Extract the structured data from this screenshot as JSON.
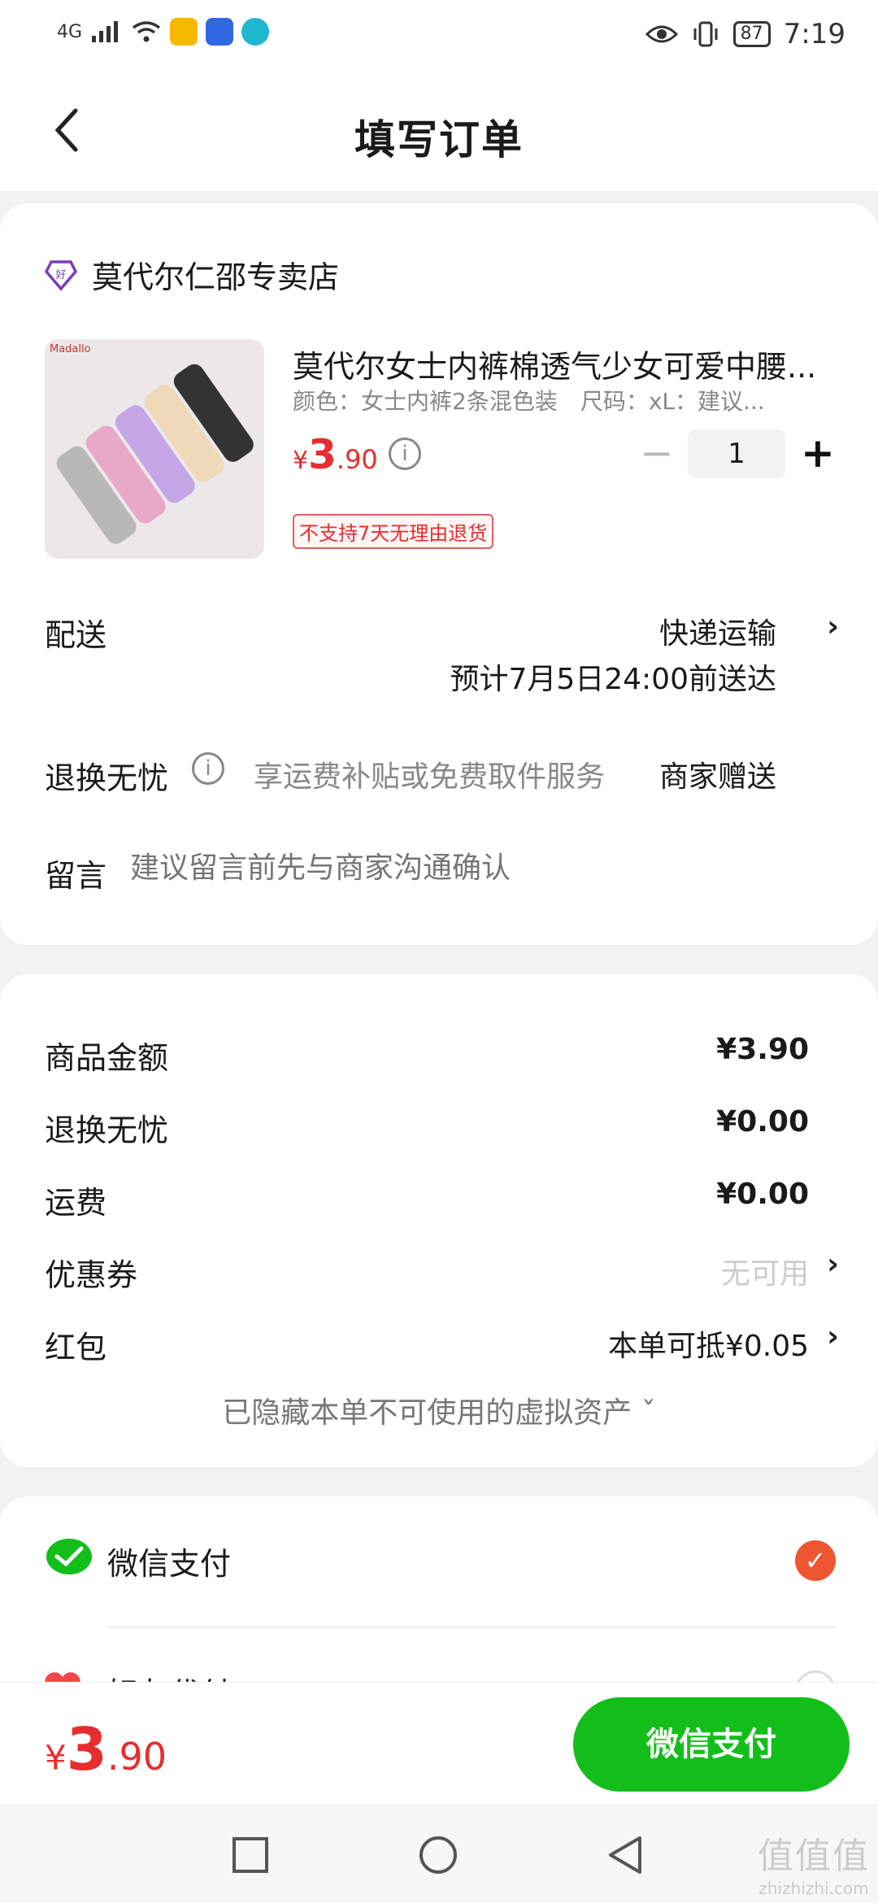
{
  "status_bar": {
    "network": "4G",
    "battery": "87",
    "time": "7:19"
  },
  "header": {
    "title": "填写订单"
  },
  "shop": {
    "name": "莫代尔仁邵专卖店"
  },
  "product": {
    "image_brand_text": "Madallo",
    "title": "莫代尔女士内裤棉透气少女可爱中腰...",
    "spec": "颜色：女士内裤2条混色装　尺码：xL：建议...",
    "price_currency": "¥",
    "price_int": "3",
    "price_dec": ".90",
    "quantity": "1",
    "minus": "−",
    "plus": "+",
    "tag": "不支持7天无理由退货",
    "info_glyph": "i"
  },
  "delivery": {
    "label": "配送",
    "method": "快递运输",
    "estimate": "预计7月5日24:00前送达",
    "chevron": "›"
  },
  "return_service": {
    "label": "退换无忧",
    "description": "享运费补贴或免费取件服务",
    "value": "商家赠送",
    "info_glyph": "i"
  },
  "message": {
    "label": "留言",
    "placeholder": "建议留言前先与商家沟通确认"
  },
  "summary": {
    "items": [
      {
        "label": "商品金额",
        "value": "¥3.90"
      },
      {
        "label": "退换无忧",
        "value": "¥0.00"
      },
      {
        "label": "运费",
        "value": "¥0.00"
      },
      {
        "label": "优惠券",
        "value": "无可用"
      },
      {
        "label": "红包",
        "value": "本单可抵¥0.05"
      }
    ],
    "hidden_note": "已隐藏本单不可使用的虚拟资产 ˇ"
  },
  "payment": {
    "methods": [
      {
        "label": "微信支付",
        "selected": true
      },
      {
        "label": "好友代付",
        "selected": false
      }
    ],
    "wechat_color": "#13be1b",
    "check_color": "#f05532"
  },
  "bottom": {
    "currency": "¥",
    "total_int": "3",
    "total_dec": ".90",
    "pay_button": "微信支付"
  },
  "watermark": {
    "logo": "值值值",
    "domain": "zhizhizhi.com"
  }
}
